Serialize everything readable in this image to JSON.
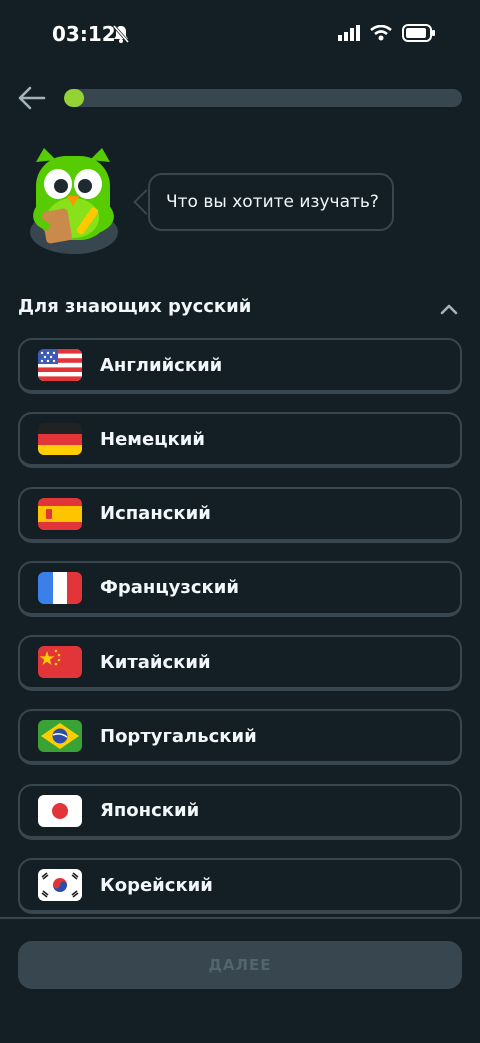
{
  "status_bar": {
    "time": "03:12"
  },
  "progress": {
    "fraction": 0.05
  },
  "prompt": {
    "text": "Что вы хотите изучать?"
  },
  "section": {
    "title": "Для знающих русский"
  },
  "languages": [
    {
      "label": "Английский",
      "flag": "flag-us-icon"
    },
    {
      "label": "Немецкий",
      "flag": "flag-de-icon"
    },
    {
      "label": "Испанский",
      "flag": "flag-es-icon"
    },
    {
      "label": "Французский",
      "flag": "flag-fr-icon"
    },
    {
      "label": "Китайский",
      "flag": "flag-cn-icon"
    },
    {
      "label": "Португальский",
      "flag": "flag-br-icon"
    },
    {
      "label": "Японский",
      "flag": "flag-jp-icon"
    },
    {
      "label": "Корейский",
      "flag": "flag-kr-icon"
    }
  ],
  "footer": {
    "continue_label": "ДАЛЕЕ"
  },
  "colors": {
    "background": "#131f24",
    "border": "#37464f",
    "accent": "#93d333",
    "text": "#f1f7fb"
  }
}
